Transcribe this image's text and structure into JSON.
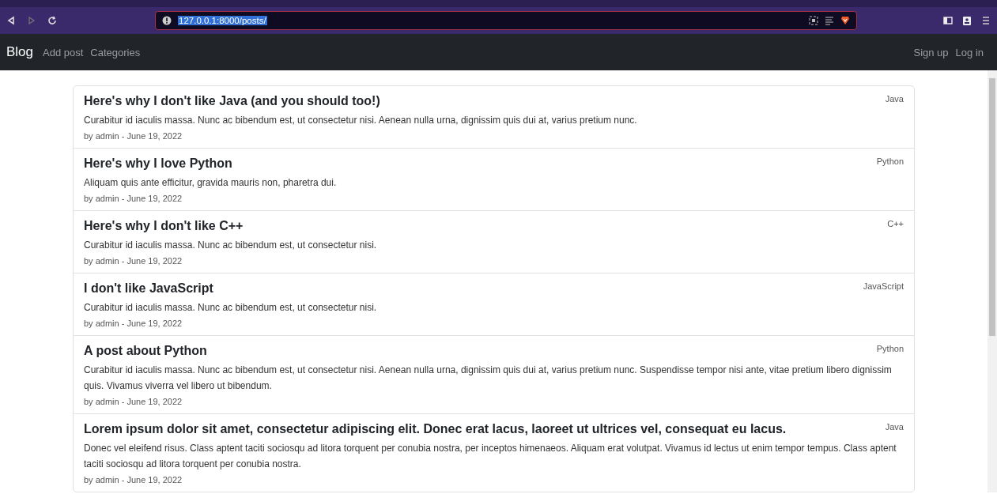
{
  "browser": {
    "url": "127.0.0.1:8000/posts/"
  },
  "navbar": {
    "brand": "Blog",
    "links": [
      "Add post",
      "Categories"
    ],
    "right_links": [
      "Sign up",
      "Log in"
    ]
  },
  "posts": [
    {
      "title": "Here's why I don't like Java (and you should too!)",
      "category": "Java",
      "body": "Curabitur id iaculis massa. Nunc ac bibendum est, ut consectetur nisi. Aenean nulla urna, dignissim quis dui at, varius pretium nunc.",
      "meta": "by admin - June 19, 2022"
    },
    {
      "title": "Here's why I love Python",
      "category": "Python",
      "body": "Aliquam quis ante efficitur, gravida mauris non, pharetra dui.",
      "meta": "by admin - June 19, 2022"
    },
    {
      "title": "Here's why I don't like C++",
      "category": "C++",
      "body": "Curabitur id iaculis massa. Nunc ac bibendum est, ut consectetur nisi.",
      "meta": "by admin - June 19, 2022"
    },
    {
      "title": "I don't like JavaScript",
      "category": "JavaScript",
      "body": "Curabitur id iaculis massa. Nunc ac bibendum est, ut consectetur nisi.",
      "meta": "by admin - June 19, 2022"
    },
    {
      "title": "A post about Python",
      "category": "Python",
      "body": "Curabitur id iaculis massa. Nunc ac bibendum est, ut consectetur nisi. Aenean nulla urna, dignissim quis dui at, varius pretium nunc. Suspendisse tempor nisi ante, vitae pretium libero dignissim quis. Vivamus viverra vel libero ut bibendum.",
      "meta": "by admin - June 19, 2022"
    },
    {
      "title": "Lorem ipsum dolor sit amet, consectetur adipiscing elit. Donec erat lacus, laoreet ut ultrices vel, consequat eu lacus.",
      "category": "Java",
      "body": "Donec vel eleifend risus. Class aptent taciti sociosqu ad litora torquent per conubia nostra, per inceptos himenaeos. Aliquam erat volutpat. Vivamus id lectus ut enim tempor tempus. Class aptent taciti sociosqu ad litora torquent per conubia nostra.",
      "meta": "by admin - June 19, 2022"
    }
  ]
}
